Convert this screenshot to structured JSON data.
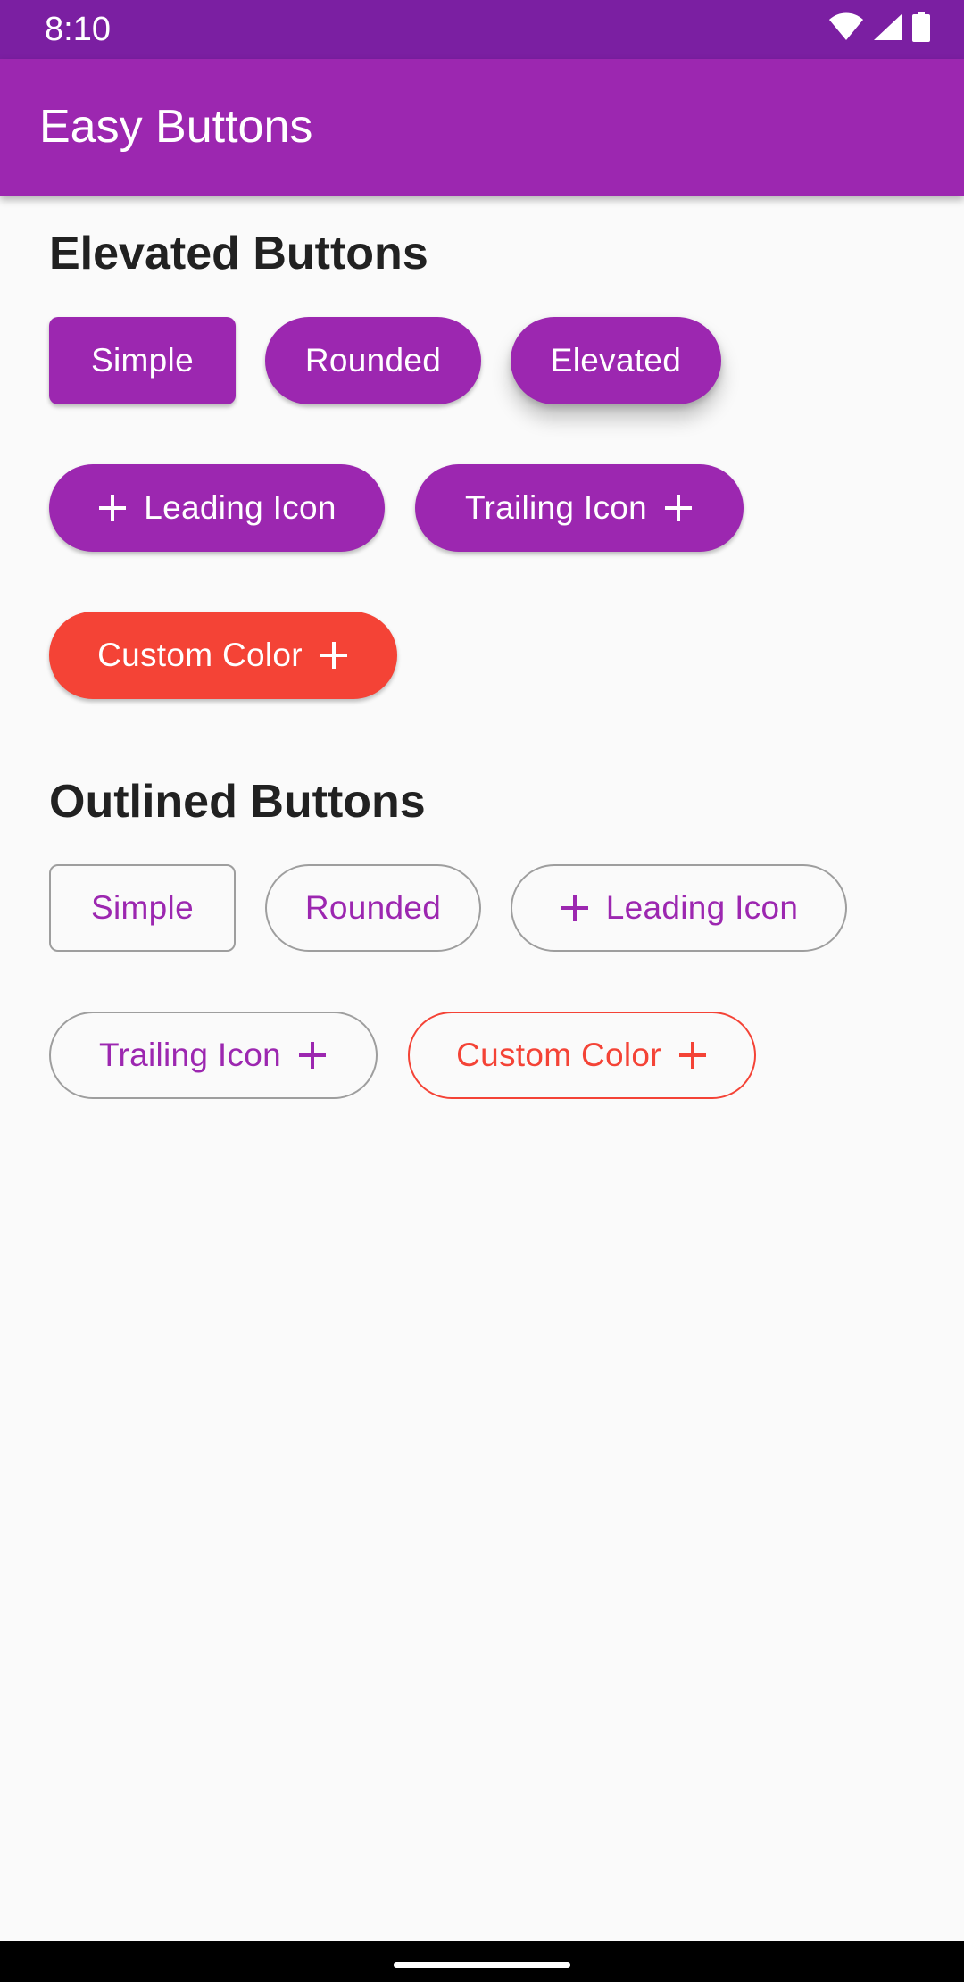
{
  "status_bar": {
    "time": "8:10",
    "icons": [
      "wifi-icon",
      "signal-icon",
      "battery-icon"
    ]
  },
  "app_bar": {
    "title": "Easy Buttons"
  },
  "colors": {
    "primary": "#9c27b0",
    "primary_dark": "#7b1fa2",
    "custom": "#f44336",
    "outline": "#9e9e9e",
    "background": "#fafafa"
  },
  "elevated_section": {
    "title": "Elevated Buttons",
    "buttons": {
      "simple": "Simple",
      "rounded": "Rounded",
      "elevated": "Elevated",
      "leading_icon": "Leading Icon",
      "trailing_icon": "Trailing Icon",
      "custom_color": "Custom Color"
    }
  },
  "outlined_section": {
    "title": "Outlined Buttons",
    "buttons": {
      "simple": "Simple",
      "rounded": "Rounded",
      "leading_icon": "Leading Icon",
      "trailing_icon": "Trailing Icon",
      "custom_color": "Custom Color"
    }
  }
}
